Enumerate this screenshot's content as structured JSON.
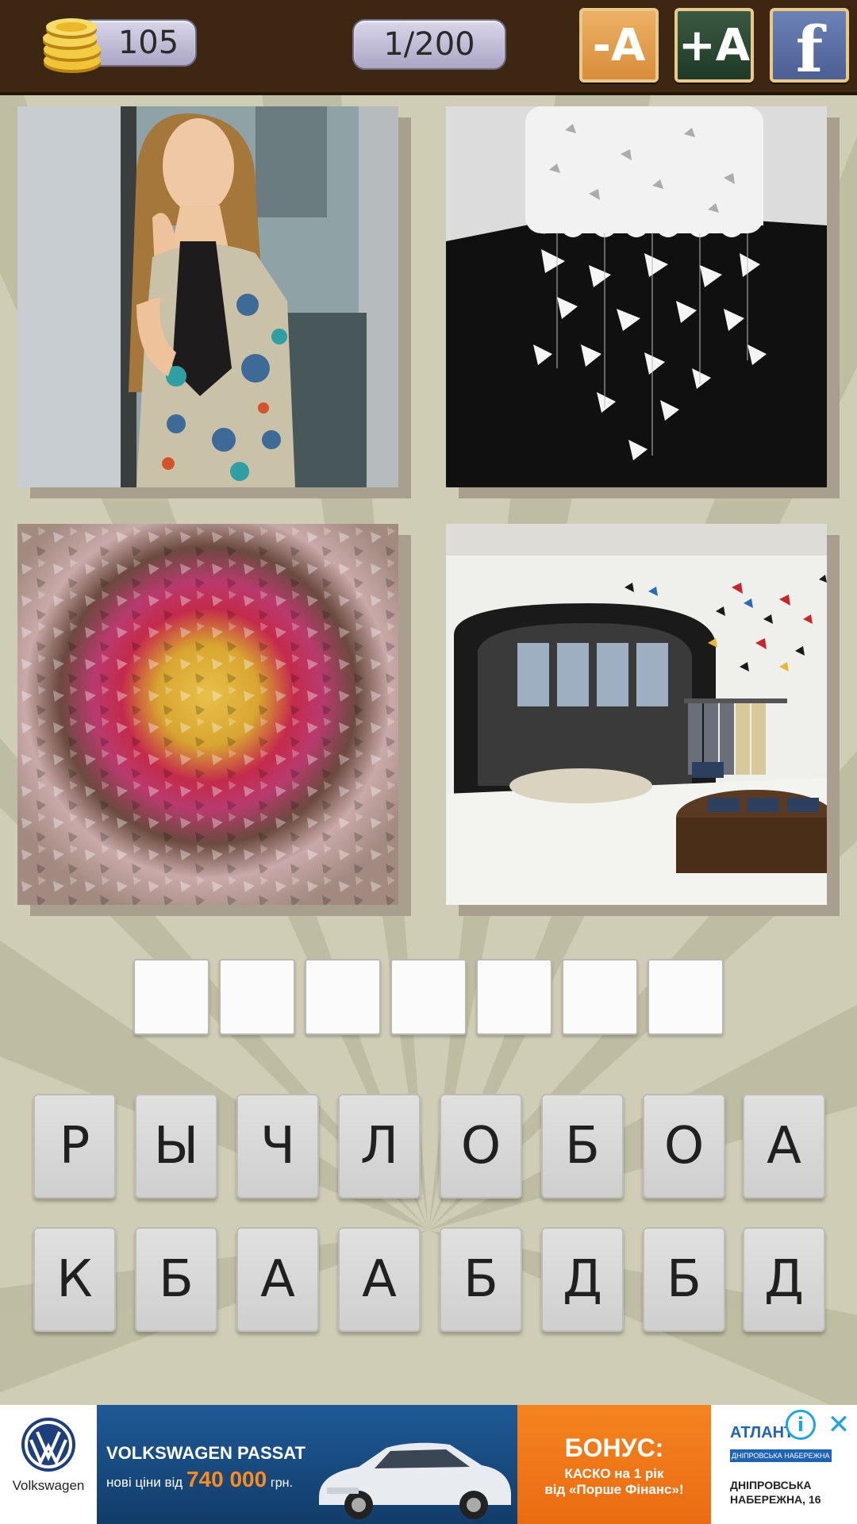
{
  "header": {
    "coins": "105",
    "level": "1/200",
    "remove_letter_label": "-A",
    "reveal_letter_label": "+A",
    "facebook_label": "f"
  },
  "photos": [
    {
      "name": "woman-butterfly-dress-photo"
    },
    {
      "name": "butterfly-lamp-photo"
    },
    {
      "name": "paper-butterflies-wall-photo"
    },
    {
      "name": "boutique-butterflies-photo"
    }
  ],
  "answer": {
    "slot_count": 7
  },
  "letters": {
    "row1": [
      "Р",
      "Ы",
      "Ч",
      "Л",
      "О",
      "Б",
      "О",
      "А"
    ],
    "row2": [
      "К",
      "Б",
      "А",
      "А",
      "Б",
      "Д",
      "Б",
      "Д"
    ]
  },
  "ad": {
    "vw_brand": "Volkswagen",
    "model": "VOLKSWAGEN PASSAT",
    "price_prefix": "нові ціни від",
    "price": "740 000",
    "price_unit": "грн.",
    "bonus_title": "БОНУС:",
    "bonus_line1": "КАСКО на 1 рік",
    "bonus_line2": "від «Порше Фінанс»!",
    "atlant": "АТЛАНТ",
    "atlant_sub": "ДНІПРОВСЬКА НАБЕРЕЖНА",
    "atlant_addr": "ДНІПРОВСЬКА НАБЕРЕЖНА, 16",
    "info_glyph": "i",
    "close_glyph": "✕"
  }
}
